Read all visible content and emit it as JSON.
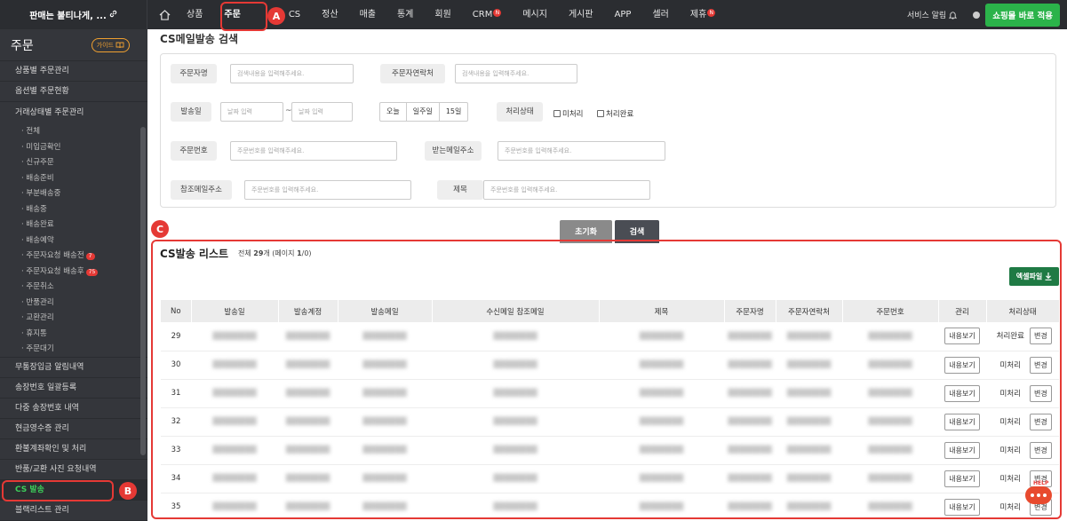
{
  "brand": {
    "name": "판매는 붙티나게, ...",
    "link_icon": "link-icon"
  },
  "nav": {
    "items": [
      {
        "label": "상품",
        "badge": ""
      },
      {
        "label": "주문",
        "badge": "",
        "active": true
      },
      {
        "label": "CS",
        "badge": ""
      },
      {
        "label": "정산",
        "badge": ""
      },
      {
        "label": "매출",
        "badge": ""
      },
      {
        "label": "통계",
        "badge": ""
      },
      {
        "label": "회원",
        "badge": ""
      },
      {
        "label": "CRM",
        "badge": "N"
      },
      {
        "label": "메시지",
        "badge": ""
      },
      {
        "label": "게시판",
        "badge": ""
      },
      {
        "label": "APP",
        "badge": ""
      },
      {
        "label": "셀러",
        "badge": ""
      },
      {
        "label": "제휴",
        "badge": "N"
      }
    ],
    "service_alarm": "서비스 알림",
    "apply_button": "쇼핑몰 바로 적용"
  },
  "sidebar": {
    "title": "주문",
    "guide": "가이드",
    "top_items": [
      "상품별 주문관리",
      "옵션별 주문현황"
    ],
    "group": "거래상태별 주문관리",
    "sub_items": [
      {
        "label": "· 전체",
        "badge": ""
      },
      {
        "label": "· 미입금확인",
        "badge": ""
      },
      {
        "label": "· 신규주문",
        "badge": ""
      },
      {
        "label": "· 배송준비",
        "badge": ""
      },
      {
        "label": "· 부분배송중",
        "badge": ""
      },
      {
        "label": "· 배송중",
        "badge": ""
      },
      {
        "label": "· 배송완료",
        "badge": ""
      },
      {
        "label": "· 배송예약",
        "badge": ""
      },
      {
        "label": "· 주문자요청 배송전",
        "badge": "7"
      },
      {
        "label": "· 주문자요청 배송후",
        "badge": "75"
      },
      {
        "label": "· 주문취소",
        "badge": ""
      },
      {
        "label": "· 반품관리",
        "badge": ""
      },
      {
        "label": "· 교환관리",
        "badge": ""
      },
      {
        "label": "· 휴지통",
        "badge": ""
      },
      {
        "label": "· 주문대기",
        "badge": ""
      }
    ],
    "bottom_items": [
      "무통장입금 알림내역",
      "송장번호 일괄등록",
      "다중 송장번호 내역",
      "현금영수증 관리",
      "환불계좌확인 및 처리",
      "반품/교환 사진 요청내역",
      "CS 발송",
      "블랙리스트 관리"
    ],
    "active_item": "CS 발송"
  },
  "search": {
    "title": "CS메일발송 검색",
    "orderer_label": "주문자명",
    "orderer_placeholder": "검색내용을 입력해주세요.",
    "contact_label": "주문자연락처",
    "contact_placeholder": "검색내용을 입력해주세요.",
    "date_label": "발송일",
    "date_from_placeholder": "날짜 입력",
    "date_tilde": "~",
    "date_to_placeholder": "날짜 입력",
    "date_presets": [
      "오늘",
      "일주일",
      "15일"
    ],
    "status_label": "처리상태",
    "status_options": [
      "미처리",
      "처리완료"
    ],
    "order_no_label": "주문번호",
    "order_no_placeholder": "주문번호를 입력해주세요.",
    "recv_mail_label": "받는메일주소",
    "recv_mail_placeholder": "주문번호를 입력해주세요.",
    "ref_mail_label": "참조메일주소",
    "ref_mail_placeholder": "주문번호를 입력해주세요.",
    "subject_label": "제목",
    "subject_placeholder": "주문번호를 입력해주세요.",
    "reset_button": "초기화",
    "search_button": "검색"
  },
  "list": {
    "title": "CS발송 리스트",
    "count_prefix": "전체 ",
    "count": "29",
    "count_mid": "개 (페이지 ",
    "page": "1",
    "count_suffix": "/0)",
    "excel_button": "엑셀파일",
    "columns": [
      "No",
      "발송일",
      "발송계정",
      "발송메일",
      "수신메일 참조메일",
      "제목",
      "주문자명",
      "주문자연락처",
      "주문번호",
      "관리",
      "처리상태"
    ],
    "view_button": "내용보기",
    "change_button": "변경",
    "rows": [
      {
        "no": "29",
        "status": "처리완료"
      },
      {
        "no": "30",
        "status": "미처리"
      },
      {
        "no": "31",
        "status": "미처리"
      },
      {
        "no": "32",
        "status": "미처리"
      },
      {
        "no": "33",
        "status": "미처리"
      },
      {
        "no": "34",
        "status": "미처리"
      },
      {
        "no": "35",
        "status": "미처리"
      }
    ]
  },
  "annotations": {
    "a": "A",
    "b": "B",
    "c": "C"
  },
  "help": "HELP",
  "colors": {
    "accent_green": "#2bb34a",
    "annotation_red": "#e53935",
    "topbar": "#2b2d31",
    "sidebar": "#34363b"
  }
}
